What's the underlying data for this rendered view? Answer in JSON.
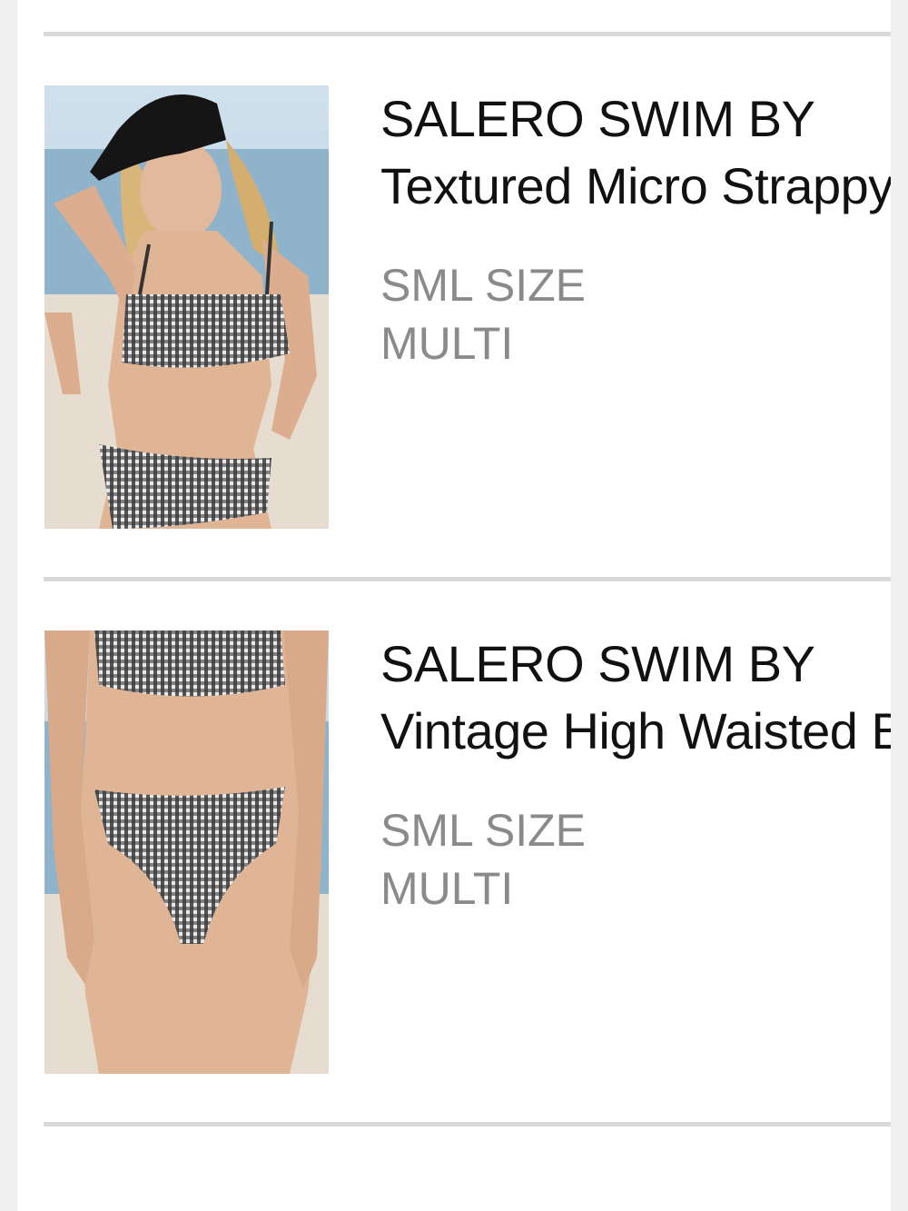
{
  "products": [
    {
      "brand": "SALERO SWIM BY",
      "name": "Textured Micro Strappy Bralette Bikini Top",
      "size": "SML SIZE",
      "color": "MULTI",
      "image": "product-photo-bikini-top"
    },
    {
      "brand": "SALERO SWIM BY",
      "name": "Vintage High Waisted Bikini Bottom",
      "size": "SML SIZE",
      "color": "MULTI",
      "image": "product-photo-bikini-bottom"
    }
  ],
  "colors": {
    "divider": "#d9d9d9",
    "text": "#111111",
    "meta_text": "#8a8a8a",
    "background": "#ffffff",
    "frame": "#f0f0f0"
  }
}
